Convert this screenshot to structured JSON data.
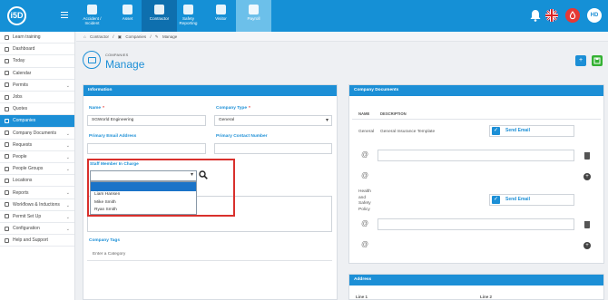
{
  "app": {
    "logo_text": "i5D"
  },
  "nav": [
    {
      "label_l1": "Accident /",
      "label_l2": "Incident"
    },
    {
      "label_l1": "Asset",
      "label_l2": ""
    },
    {
      "label_l1": "Contractor",
      "label_l2": ""
    },
    {
      "label_l1": "Safety",
      "label_l2": "Reporting"
    },
    {
      "label_l1": "Visitor",
      "label_l2": ""
    },
    {
      "label_l1": "Payroll",
      "label_l2": ""
    }
  ],
  "user": {
    "initials": "HD"
  },
  "sidebar": {
    "items": [
      {
        "label": "Learn training",
        "chev": ""
      },
      {
        "label": "Dashboard",
        "chev": ""
      },
      {
        "label": "Today",
        "chev": ""
      },
      {
        "label": "Calendar",
        "chev": ""
      },
      {
        "label": "Permits",
        "chev": "⌄"
      },
      {
        "label": "Jobs",
        "chev": ""
      },
      {
        "label": "Quotes",
        "chev": ""
      },
      {
        "label": "Companies",
        "chev": ""
      },
      {
        "label": "Company Documents",
        "chev": "⌄"
      },
      {
        "label": "Requests",
        "chev": "⌄"
      },
      {
        "label": "People",
        "chev": "⌄"
      },
      {
        "label": "People Groups",
        "chev": "⌄"
      },
      {
        "label": "Locations",
        "chev": ""
      },
      {
        "label": "Reports",
        "chev": "⌄"
      },
      {
        "label": "Workflows & Inductions",
        "chev": "⌄"
      },
      {
        "label": "Permit Set Up",
        "chev": "⌄"
      },
      {
        "label": "Configuration",
        "chev": "⌄"
      },
      {
        "label": "Help and Support",
        "chev": ""
      }
    ]
  },
  "breadcrumb": {
    "a": "Contractor",
    "b": "Companies",
    "c": "Manage"
  },
  "header": {
    "kicker": "COMPANIES",
    "title": "Manage"
  },
  "info": {
    "title": "Information",
    "name_label": "Name",
    "name_value": "SGWorld Engineering",
    "type_label": "Company Type",
    "type_value": "General",
    "email_label": "Primary Email Address",
    "contact_label": "Primary Contact Number",
    "staff_label": "Staff Member In Charge",
    "staff_options": [
      "Liam Hansen",
      "Mike Smith",
      "Ryan Smith"
    ],
    "tags_label": "Company Tags",
    "tags_placeholder": "Enter a Category"
  },
  "docs": {
    "title": "Company Documents",
    "col_name": "NAME",
    "col_desc": "DESCRIPTION",
    "row1_name": "General",
    "row1_desc": "General Insurance Template",
    "row1_send": "Send Email",
    "row2_name_l1": "Health",
    "row2_name_l2": "and",
    "row2_name_l3": "Safety",
    "row2_name_l4": "Policy",
    "row2_send": "Send Email",
    "at": "@"
  },
  "address": {
    "title": "Address",
    "line1": "Line 1",
    "line2": "Line 2"
  }
}
